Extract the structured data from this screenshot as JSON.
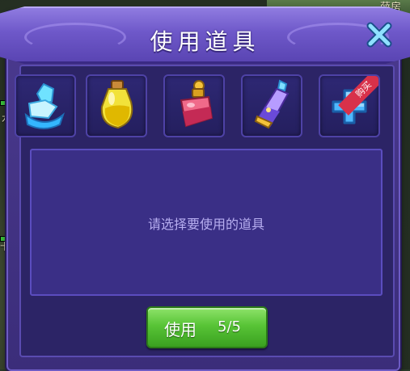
{
  "background": {
    "label_top_right": "薛房",
    "label_left_1": "水",
    "label_left_2": "卡巴"
  },
  "dialog": {
    "title": "使用道具",
    "close_icon": "close-x-icon",
    "description": "请选择要使用的道具",
    "use_button": {
      "label": "使用",
      "count": "5/5"
    }
  },
  "items": [
    {
      "name": "ice-crystal-item",
      "icon": "ice-crystal-icon"
    },
    {
      "name": "yellow-potion",
      "icon": "yellow-potion-icon"
    },
    {
      "name": "red-potion",
      "icon": "red-potion-icon"
    },
    {
      "name": "purple-elixir",
      "icon": "purple-elixir-icon"
    },
    {
      "name": "buy-slot",
      "icon": "plus-icon",
      "ribbon": "购买"
    }
  ],
  "colors": {
    "dialog_bg": "#3b2d7a",
    "title_bar": "#6e58c9",
    "use_button": "#58c436",
    "buy_ribbon": "#d8314a",
    "plus": "#4fb8ff"
  }
}
